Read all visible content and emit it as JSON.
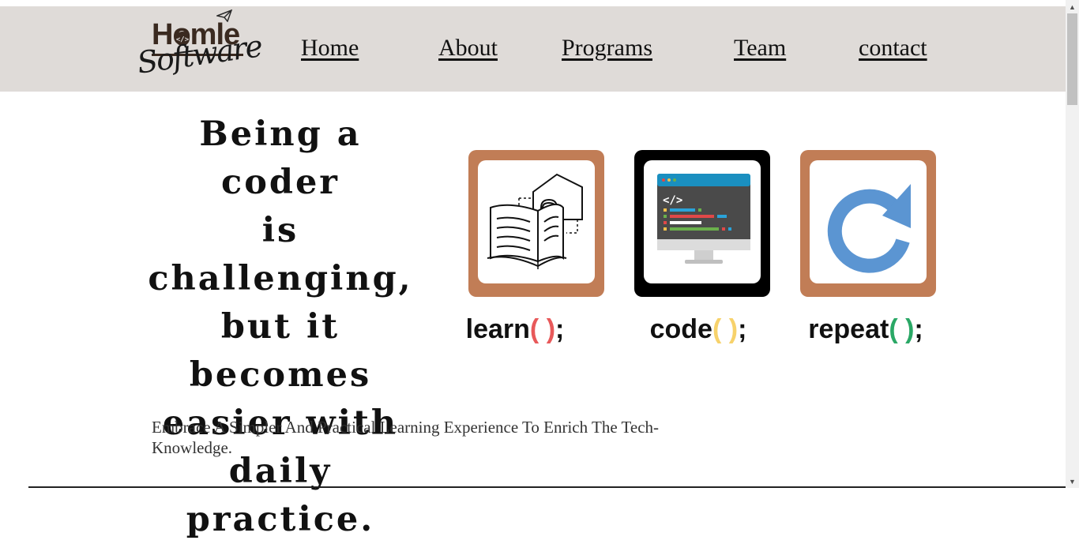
{
  "logo": {
    "title": "Homle",
    "subtitle": "Software"
  },
  "nav": [
    {
      "label": "Home"
    },
    {
      "label": "About"
    },
    {
      "label": "Programs"
    },
    {
      "label": "Team"
    },
    {
      "label": "contact"
    }
  ],
  "hero": {
    "lines": [
      "Being a coder",
      "is challenging,",
      "but it becomes",
      "easier with",
      "daily practice."
    ]
  },
  "cards": [
    {
      "name": "learn",
      "suffix": ";",
      "icon": "open-book-house-icon",
      "border_color": "#c17d56",
      "paren_color": "#e8595a"
    },
    {
      "name": "code",
      "suffix": ";",
      "icon": "code-monitor-icon",
      "border_color": "#000000",
      "paren_color": "#f7d26b"
    },
    {
      "name": "repeat",
      "suffix": ";",
      "icon": "repeat-arrow-icon",
      "border_color": "#c17d56",
      "paren_color": "#2aa866"
    }
  ],
  "tagline": "Embrace A Simpler And Practical Learning Experience To Enrich The Tech-Knowledge."
}
